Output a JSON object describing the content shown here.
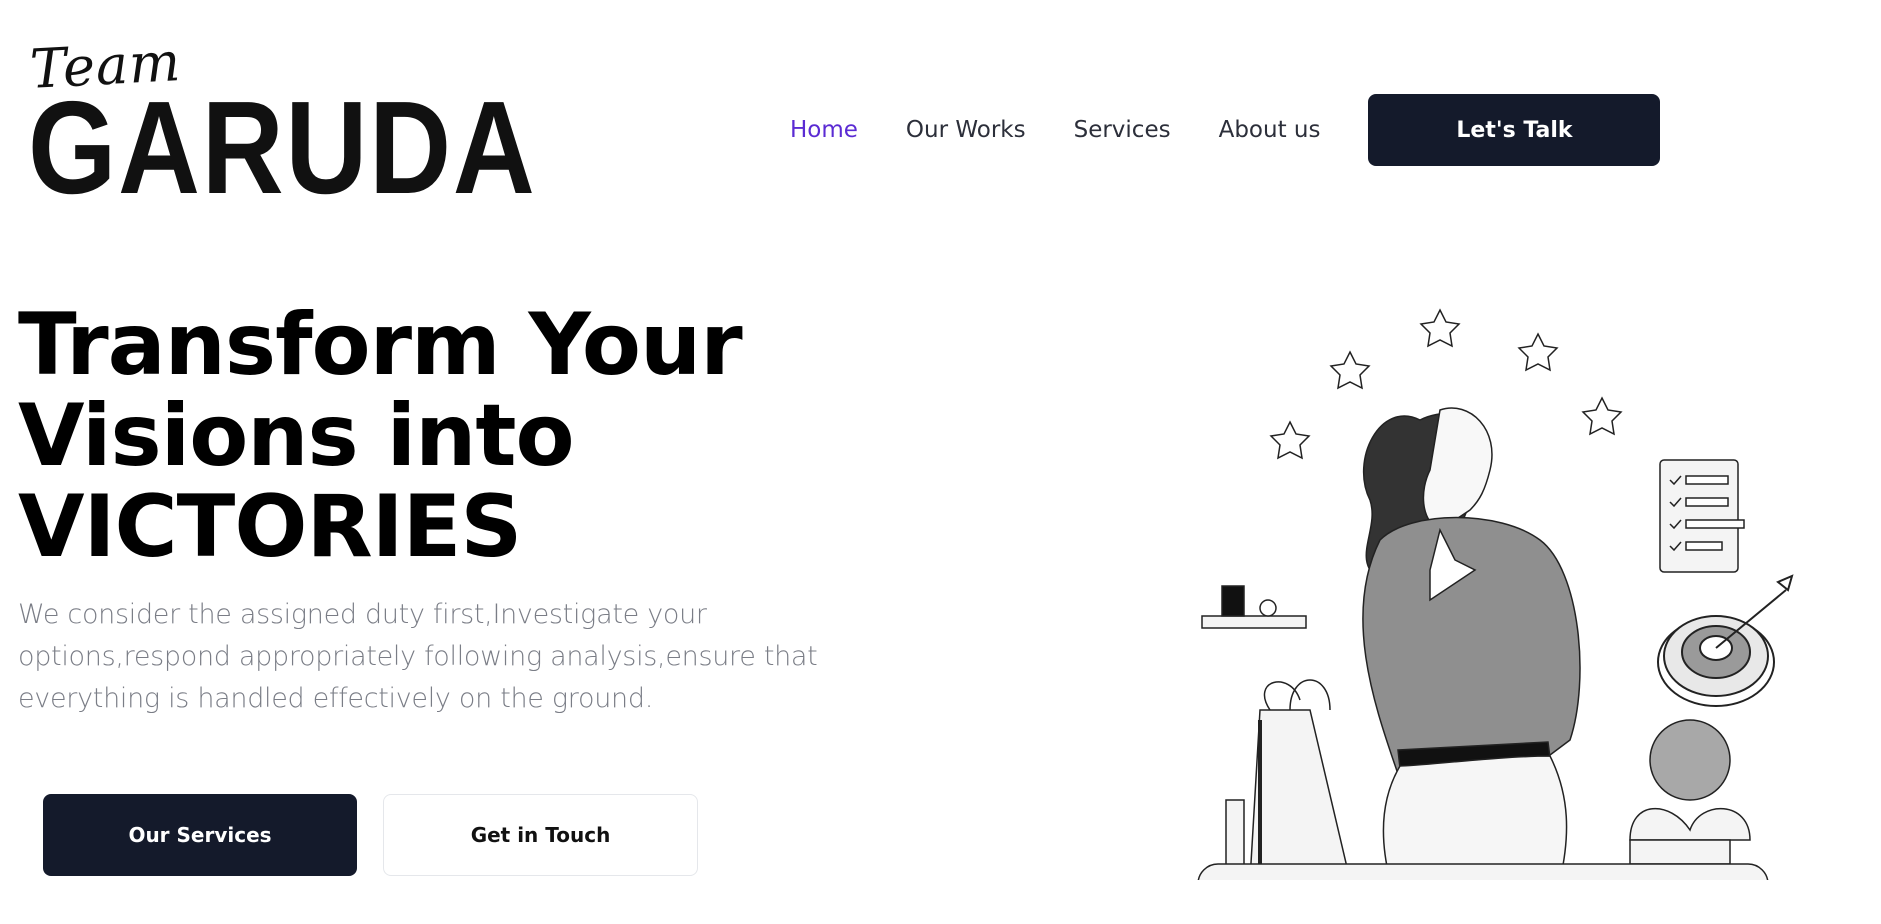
{
  "brand": {
    "team": "Team",
    "name": "GARUDA"
  },
  "nav": {
    "items": [
      {
        "label": "Home",
        "active": true
      },
      {
        "label": "Our Works",
        "active": false
      },
      {
        "label": "Services",
        "active": false
      },
      {
        "label": "About us",
        "active": false
      }
    ],
    "cta_label": "Let's Talk"
  },
  "hero": {
    "title_lines": [
      "Transform Your",
      "Visions into",
      "VICTORIES"
    ],
    "description": "We consider the assigned duty first,Investigate your options,respond appropriately following analysis,ensure that everything is handled effectively on the ground.",
    "primary_button": "Our Services",
    "secondary_button": "Get in Touch"
  },
  "colors": {
    "accent": "#5b2bd3",
    "dark": "#141a2b",
    "text": "#2c2f3a",
    "muted": "#7a7d86"
  },
  "illustration": {
    "icon": "woman-thumbs-up-illustration"
  }
}
